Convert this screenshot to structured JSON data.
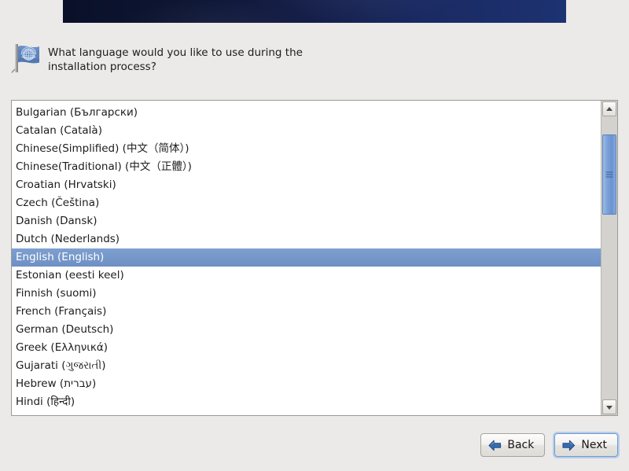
{
  "window": {
    "title": "Language Selection",
    "background_color": "#ebeae8"
  },
  "banner": {
    "name": "title-banner",
    "gradient_from": "#0a1028",
    "gradient_to": "#1d3271"
  },
  "prompt": {
    "icon": "language-flag-icon",
    "text": "What language would you like to use during the\ninstallation process?"
  },
  "language_list": {
    "selected_value": "English (English)",
    "items": [
      {
        "label": "Bulgarian (Български)",
        "selected": false
      },
      {
        "label": "Catalan (Català)",
        "selected": false
      },
      {
        "label": "Chinese(Simplified) (中文（简体）)",
        "selected": false
      },
      {
        "label": "Chinese(Traditional) (中文（正體）)",
        "selected": false
      },
      {
        "label": "Croatian (Hrvatski)",
        "selected": false
      },
      {
        "label": "Czech (Čeština)",
        "selected": false
      },
      {
        "label": "Danish (Dansk)",
        "selected": false
      },
      {
        "label": "Dutch (Nederlands)",
        "selected": false
      },
      {
        "label": "English (English)",
        "selected": true
      },
      {
        "label": "Estonian (eesti keel)",
        "selected": false
      },
      {
        "label": "Finnish (suomi)",
        "selected": false
      },
      {
        "label": "French (Français)",
        "selected": false
      },
      {
        "label": "German (Deutsch)",
        "selected": false
      },
      {
        "label": "Greek (Ελληνικά)",
        "selected": false
      },
      {
        "label": "Gujarati (ગુજરાતી)",
        "selected": false
      },
      {
        "label": "Hebrew (עברית)",
        "selected": false
      },
      {
        "label": "Hindi (हिन्दी)",
        "selected": false
      }
    ]
  },
  "scrollbar": {
    "up_icon": "chevron-up-icon",
    "down_icon": "chevron-down-icon",
    "thumb_color": "#7ba1d8"
  },
  "footer": {
    "back": {
      "label": "Back",
      "icon": "arrow-left-icon",
      "focused": false
    },
    "next": {
      "label": "Next",
      "icon": "arrow-right-icon",
      "focused": true
    }
  }
}
